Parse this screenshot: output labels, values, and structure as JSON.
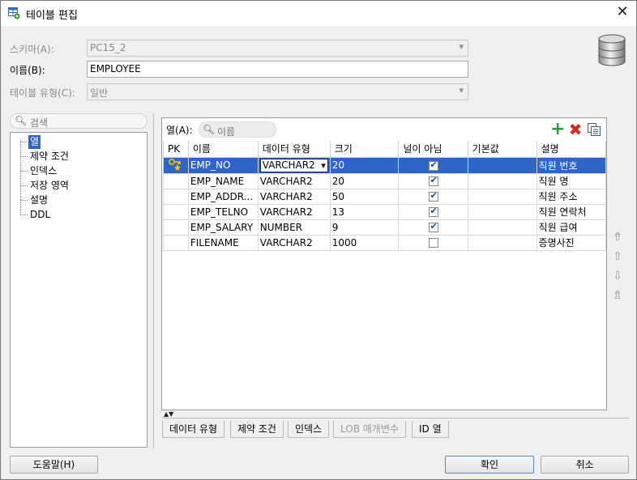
{
  "window": {
    "title": "테이블 편집",
    "close_glyph": "✕"
  },
  "form": {
    "schema": {
      "label": "스키마(A):",
      "value": "PC15_2"
    },
    "name": {
      "label": "이름(B):",
      "value": "EMPLOYEE"
    },
    "table_type": {
      "label": "테이블 유형(C):",
      "value": "일반"
    }
  },
  "left": {
    "search_placeholder": "검색",
    "tree": [
      {
        "label": "열",
        "selected": true
      },
      {
        "label": "제약 조건"
      },
      {
        "label": "인덱스"
      },
      {
        "label": "저장 영역"
      },
      {
        "label": "설명"
      },
      {
        "label": "DDL"
      }
    ]
  },
  "columns_panel": {
    "label": "열(A):",
    "search_placeholder": "이름",
    "headers": [
      "PK",
      "이름",
      "데이터 유형",
      "크기",
      "널이 아님",
      "기본값",
      "설명"
    ],
    "rows": [
      {
        "pk": true,
        "name": "EMP_NO",
        "type": "VARCHAR2",
        "size": "20",
        "not_null": true,
        "default": "",
        "comment": "직원 번호",
        "selected": true
      },
      {
        "pk": false,
        "name": "EMP_NAME",
        "type": "VARCHAR2",
        "size": "20",
        "not_null": true,
        "default": "",
        "comment": "직원 명"
      },
      {
        "pk": false,
        "name": "EMP_ADDR...",
        "type": "VARCHAR2",
        "size": "50",
        "not_null": true,
        "default": "",
        "comment": "직원 주소"
      },
      {
        "pk": false,
        "name": "EMP_TELNO",
        "type": "VARCHAR2",
        "size": "13",
        "not_null": true,
        "default": "",
        "comment": "직원 연락처"
      },
      {
        "pk": false,
        "name": "EMP_SALARY",
        "type": "NUMBER",
        "size": "9",
        "not_null": true,
        "default": "",
        "comment": "직원 급여"
      },
      {
        "pk": false,
        "name": "FILENAME",
        "type": "VARCHAR2",
        "size": "1000",
        "not_null": false,
        "default": "",
        "comment": "증명사진"
      }
    ]
  },
  "bottom_tabs": [
    {
      "label": "데이터 유형"
    },
    {
      "label": "제약 조건"
    },
    {
      "label": "인덱스"
    },
    {
      "label": "LOB 매개변수",
      "disabled": true
    },
    {
      "label": "ID 열"
    }
  ],
  "buttons": {
    "help": "도움말(H)",
    "ok": "확인",
    "cancel": "취소"
  },
  "icons": {
    "add": "add-column-icon",
    "remove": "remove-column-icon",
    "copy": "copy-column-icon",
    "move_top": "move-top-icon",
    "move_up": "move-up-icon",
    "move_down": "move-down-icon",
    "move_bottom": "move-bottom-icon"
  },
  "colors": {
    "selection": "#2f65ca",
    "add": "#2e9e2e",
    "remove": "#d42a1e"
  }
}
